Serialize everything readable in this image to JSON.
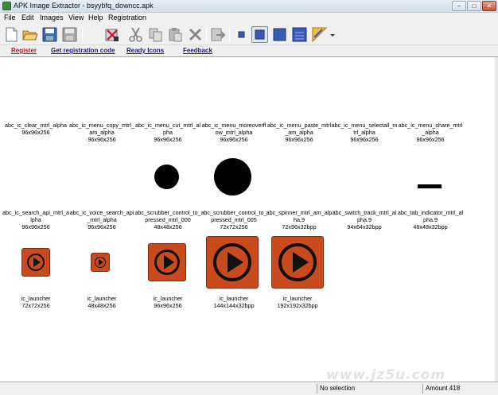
{
  "window": {
    "title": "APK Image Extractor - bsyybfq_downcc.apk",
    "minimize_glyph": "–",
    "maximize_glyph": "□",
    "close_glyph": "✕"
  },
  "menu": [
    "File",
    "Edit",
    "Images",
    "View",
    "Help",
    "Registration"
  ],
  "toolbar": {
    "icons": [
      "new-icon",
      "open-folder-icon",
      "save-icon",
      "save-all-icon",
      "delete-selection-icon",
      "cut-icon",
      "copy-icon",
      "paste-icon",
      "delete-icon",
      "export-icon",
      "tiny-thumbnail-icon",
      "small-thumbnail-icon",
      "medium-thumbnail-icon",
      "large-thumbnail-icon",
      "sort-icon",
      "dropdown-arrow-icon"
    ]
  },
  "links": {
    "register": "Register",
    "get_code": "Get registration code",
    "ready_icons": "Ready Icons",
    "feedback": "Feedback"
  },
  "images": {
    "row1": [
      {
        "name": "abc_ic_clear_mtrl_alpha",
        "dims": "96x96x256"
      },
      {
        "name": "abc_ic_menu_copy_mtrl_am_alpha",
        "dims": "96x96x256"
      },
      {
        "name": "abc_ic_menu_cut_mtrl_alpha",
        "dims": "96x96x256"
      },
      {
        "name": "abc_ic_menu_moreoverflow_mtrl_alpha",
        "dims": "96x96x256"
      },
      {
        "name": "abc_ic_menu_paste_mtrl_am_alpha",
        "dims": "96x96x256"
      },
      {
        "name": "abc_ic_menu_selectall_mtrl_alpha",
        "dims": "96x96x256"
      },
      {
        "name": "abc_ic_menu_share_mtrl_alpha",
        "dims": "96x96x256"
      }
    ],
    "row2": [
      {
        "name": "abc_ic_search_api_mtrl_alpha",
        "dims": "96x96x256"
      },
      {
        "name": "abc_ic_voice_search_api_mtrl_alpha",
        "dims": "96x96x256"
      },
      {
        "name": "abc_scrubber_control_to_pressed_mtrl_000",
        "dims": "48x48x256"
      },
      {
        "name": "abc_scrubber_control_to_pressed_mtrl_005",
        "dims": "72x72x256"
      },
      {
        "name": "abc_spinner_mtrl_am_alpha.9",
        "dims": "72x96x32bpp"
      },
      {
        "name": "abc_switch_track_mtrl_alpha.9",
        "dims": "94x64x32bpp"
      },
      {
        "name": "abc_tab_indicator_mtrl_alpha.9",
        "dims": "48x48x32bpp"
      }
    ],
    "row3": [
      {
        "name": "ic_launcher",
        "dims": "72x72x256"
      },
      {
        "name": "ic_launcher",
        "dims": "48x48x256"
      },
      {
        "name": "ic_launcher",
        "dims": "96x96x256"
      },
      {
        "name": "ic_launcher",
        "dims": "144x144x32bpp"
      },
      {
        "name": "ic_launcher",
        "dims": "192x192x32bpp"
      }
    ]
  },
  "watermark": "www.jz5u.com",
  "status": {
    "selection": "No selection",
    "amount": "Amount 418"
  },
  "colors": {
    "launcher_bg": "#c94a1c",
    "link_red": "#c01818",
    "link_blue": "#1a1a8a"
  }
}
